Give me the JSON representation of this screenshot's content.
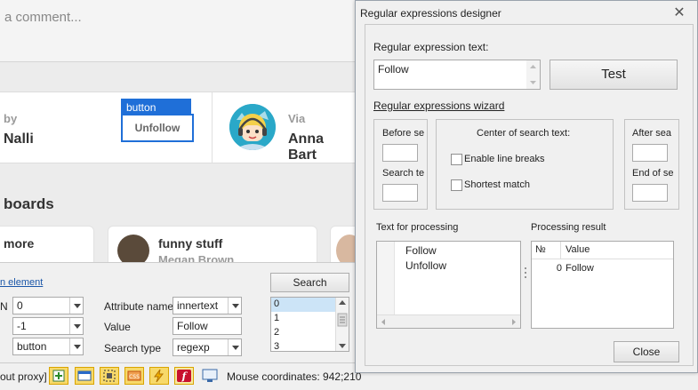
{
  "web": {
    "comment_placeholder": "a comment...",
    "pin_left_small": "by",
    "pin_left_name": "Nalli",
    "button_tag": "button",
    "unfollow_label": "Unfollow",
    "via_label": "Via",
    "via_name": "Anna Bart",
    "boards_title": "boards",
    "card1_title": "more",
    "card2_title": "funny stuff",
    "card2_sub": "Megan Brown"
  },
  "tool": {
    "link_text": "n element",
    "search_button": "Search",
    "field1_prefix": "N",
    "field1_value": "0",
    "field2_value": "-1",
    "field3_value": "button",
    "attribute_label": "Attribute name",
    "attribute_value": "innertext",
    "value_label": "Value",
    "value_value": "Follow",
    "search_type_label": "Search type",
    "search_type_value": "regexp",
    "index_list": [
      "0",
      "1",
      "2",
      "3"
    ]
  },
  "status": {
    "proxy_text": "out proxy]",
    "mouse_coords": "Mouse coordinates: 942;210",
    "icons": [
      "add-icon",
      "window-icon",
      "select-frame-icon",
      "css-icon",
      "lightning-icon",
      "flash-icon",
      "screen-icon"
    ]
  },
  "dialog": {
    "title": "Regular expressions designer",
    "regex_label": "Regular expression text:",
    "regex_value": "Follow",
    "test_button": "Test",
    "wizard_link": "Regular expressions wizard",
    "before_label1": "Before se",
    "before_label2": "Search te",
    "center_label": "Center of search text:",
    "enable_line_breaks": "Enable line breaks",
    "shortest_match": "Shortest match",
    "after_label1": "After sea",
    "after_label2": "End of se",
    "text_for_processing_label": "Text for processing",
    "text_for_processing": [
      "Follow",
      "Unfollow"
    ],
    "processing_result_label": "Processing result",
    "result_columns": [
      "№",
      "Value"
    ],
    "result_rows": [
      {
        "n": "0",
        "value": "Follow"
      }
    ],
    "close_button": "Close"
  }
}
